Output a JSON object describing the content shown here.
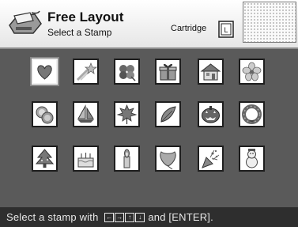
{
  "header": {
    "title": "Free Layout",
    "subtitle": "Select a Stamp",
    "cartridge_label": "Cartridge",
    "cartridge_size": "L",
    "app_icon": "printer-icon"
  },
  "stamps": [
    {
      "name": "heart",
      "selected": true
    },
    {
      "name": "shooting-star",
      "selected": false
    },
    {
      "name": "clover",
      "selected": false
    },
    {
      "name": "gift",
      "selected": false
    },
    {
      "name": "house",
      "selected": false
    },
    {
      "name": "flower",
      "selected": false
    },
    {
      "name": "fruit-slices",
      "selected": false
    },
    {
      "name": "sailboat",
      "selected": false
    },
    {
      "name": "maple-leaf",
      "selected": false
    },
    {
      "name": "leaves",
      "selected": false
    },
    {
      "name": "jack-o-lantern",
      "selected": false
    },
    {
      "name": "wreath",
      "selected": false
    },
    {
      "name": "christmas-tree",
      "selected": false
    },
    {
      "name": "birthday-cake",
      "selected": false
    },
    {
      "name": "candle",
      "selected": false
    },
    {
      "name": "ginkgo-leaf",
      "selected": false
    },
    {
      "name": "party-popper",
      "selected": false
    },
    {
      "name": "snowman",
      "selected": false
    }
  ],
  "footer": {
    "text_before": "Select a stamp with ",
    "keys": [
      "←",
      "→",
      "↑",
      "↓"
    ],
    "text_after": "and [ENTER]."
  },
  "colors": {
    "background": "#5a5a5a",
    "header_bg": "#f2f2f2",
    "footer_bg": "#2e2e2e",
    "stamp_border": "#1e1e1e",
    "selected_border": "#f0f0f0"
  }
}
